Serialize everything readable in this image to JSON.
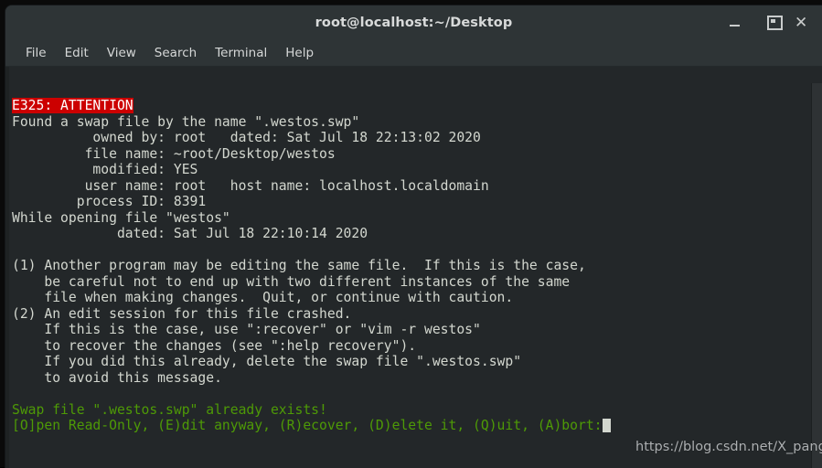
{
  "window": {
    "title": "root@localhost:~/Desktop",
    "controls": {
      "minimize": "–",
      "maximize": "□",
      "close": "✕"
    }
  },
  "menubar": {
    "items": [
      {
        "label": "File"
      },
      {
        "label": "Edit"
      },
      {
        "label": "View"
      },
      {
        "label": "Search"
      },
      {
        "label": "Terminal"
      },
      {
        "label": "Help"
      }
    ]
  },
  "terminal": {
    "error_badge": "E325: ATTENTION",
    "lines": [
      "Found a swap file by the name \".westos.swp\"",
      "          owned by: root   dated: Sat Jul 18 22:13:02 2020",
      "         file name: ~root/Desktop/westos",
      "          modified: YES",
      "         user name: root   host name: localhost.localdomain",
      "        process ID: 8391",
      "While opening file \"westos\"",
      "             dated: Sat Jul 18 22:10:14 2020",
      "",
      "(1) Another program may be editing the same file.  If this is the case,",
      "    be careful not to end up with two different instances of the same",
      "    file when making changes.  Quit, or continue with caution.",
      "(2) An edit session for this file crashed.",
      "    If this is the case, use \":recover\" or \"vim -r westos\"",
      "    to recover the changes (see \":help recovery\").",
      "    If you did this already, delete the swap file \".westos.swp\"",
      "    to avoid this message.",
      ""
    ],
    "green_lines": [
      "Swap file \".westos.swp\" already exists!",
      "[O]pen Read-Only, (E)dit anyway, (R)ecover, (D)elete it, (Q)uit, (A)bort:"
    ]
  },
  "watermark": {
    "text": "https://blog.csdn.net/X_pang"
  },
  "colors": {
    "terminal_bg": "#232729",
    "chrome_bg": "#2e3436",
    "text_fg": "#d3d7cf",
    "green": "#4e9a06",
    "error_bg": "#cc0000",
    "error_fg": "#ffffff"
  }
}
